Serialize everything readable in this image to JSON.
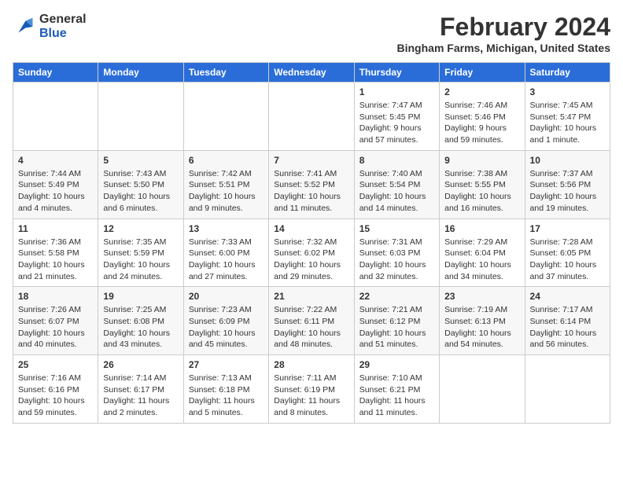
{
  "header": {
    "logo_line1": "General",
    "logo_line2": "Blue",
    "month_year": "February 2024",
    "location": "Bingham Farms, Michigan, United States"
  },
  "weekdays": [
    "Sunday",
    "Monday",
    "Tuesday",
    "Wednesday",
    "Thursday",
    "Friday",
    "Saturday"
  ],
  "weeks": [
    [
      {
        "day": "",
        "info": ""
      },
      {
        "day": "",
        "info": ""
      },
      {
        "day": "",
        "info": ""
      },
      {
        "day": "",
        "info": ""
      },
      {
        "day": "1",
        "info": "Sunrise: 7:47 AM\nSunset: 5:45 PM\nDaylight: 9 hours\nand 57 minutes."
      },
      {
        "day": "2",
        "info": "Sunrise: 7:46 AM\nSunset: 5:46 PM\nDaylight: 9 hours\nand 59 minutes."
      },
      {
        "day": "3",
        "info": "Sunrise: 7:45 AM\nSunset: 5:47 PM\nDaylight: 10 hours\nand 1 minute."
      }
    ],
    [
      {
        "day": "4",
        "info": "Sunrise: 7:44 AM\nSunset: 5:49 PM\nDaylight: 10 hours\nand 4 minutes."
      },
      {
        "day": "5",
        "info": "Sunrise: 7:43 AM\nSunset: 5:50 PM\nDaylight: 10 hours\nand 6 minutes."
      },
      {
        "day": "6",
        "info": "Sunrise: 7:42 AM\nSunset: 5:51 PM\nDaylight: 10 hours\nand 9 minutes."
      },
      {
        "day": "7",
        "info": "Sunrise: 7:41 AM\nSunset: 5:52 PM\nDaylight: 10 hours\nand 11 minutes."
      },
      {
        "day": "8",
        "info": "Sunrise: 7:40 AM\nSunset: 5:54 PM\nDaylight: 10 hours\nand 14 minutes."
      },
      {
        "day": "9",
        "info": "Sunrise: 7:38 AM\nSunset: 5:55 PM\nDaylight: 10 hours\nand 16 minutes."
      },
      {
        "day": "10",
        "info": "Sunrise: 7:37 AM\nSunset: 5:56 PM\nDaylight: 10 hours\nand 19 minutes."
      }
    ],
    [
      {
        "day": "11",
        "info": "Sunrise: 7:36 AM\nSunset: 5:58 PM\nDaylight: 10 hours\nand 21 minutes."
      },
      {
        "day": "12",
        "info": "Sunrise: 7:35 AM\nSunset: 5:59 PM\nDaylight: 10 hours\nand 24 minutes."
      },
      {
        "day": "13",
        "info": "Sunrise: 7:33 AM\nSunset: 6:00 PM\nDaylight: 10 hours\nand 27 minutes."
      },
      {
        "day": "14",
        "info": "Sunrise: 7:32 AM\nSunset: 6:02 PM\nDaylight: 10 hours\nand 29 minutes."
      },
      {
        "day": "15",
        "info": "Sunrise: 7:31 AM\nSunset: 6:03 PM\nDaylight: 10 hours\nand 32 minutes."
      },
      {
        "day": "16",
        "info": "Sunrise: 7:29 AM\nSunset: 6:04 PM\nDaylight: 10 hours\nand 34 minutes."
      },
      {
        "day": "17",
        "info": "Sunrise: 7:28 AM\nSunset: 6:05 PM\nDaylight: 10 hours\nand 37 minutes."
      }
    ],
    [
      {
        "day": "18",
        "info": "Sunrise: 7:26 AM\nSunset: 6:07 PM\nDaylight: 10 hours\nand 40 minutes."
      },
      {
        "day": "19",
        "info": "Sunrise: 7:25 AM\nSunset: 6:08 PM\nDaylight: 10 hours\nand 43 minutes."
      },
      {
        "day": "20",
        "info": "Sunrise: 7:23 AM\nSunset: 6:09 PM\nDaylight: 10 hours\nand 45 minutes."
      },
      {
        "day": "21",
        "info": "Sunrise: 7:22 AM\nSunset: 6:11 PM\nDaylight: 10 hours\nand 48 minutes."
      },
      {
        "day": "22",
        "info": "Sunrise: 7:21 AM\nSunset: 6:12 PM\nDaylight: 10 hours\nand 51 minutes."
      },
      {
        "day": "23",
        "info": "Sunrise: 7:19 AM\nSunset: 6:13 PM\nDaylight: 10 hours\nand 54 minutes."
      },
      {
        "day": "24",
        "info": "Sunrise: 7:17 AM\nSunset: 6:14 PM\nDaylight: 10 hours\nand 56 minutes."
      }
    ],
    [
      {
        "day": "25",
        "info": "Sunrise: 7:16 AM\nSunset: 6:16 PM\nDaylight: 10 hours\nand 59 minutes."
      },
      {
        "day": "26",
        "info": "Sunrise: 7:14 AM\nSunset: 6:17 PM\nDaylight: 11 hours\nand 2 minutes."
      },
      {
        "day": "27",
        "info": "Sunrise: 7:13 AM\nSunset: 6:18 PM\nDaylight: 11 hours\nand 5 minutes."
      },
      {
        "day": "28",
        "info": "Sunrise: 7:11 AM\nSunset: 6:19 PM\nDaylight: 11 hours\nand 8 minutes."
      },
      {
        "day": "29",
        "info": "Sunrise: 7:10 AM\nSunset: 6:21 PM\nDaylight: 11 hours\nand 11 minutes."
      },
      {
        "day": "",
        "info": ""
      },
      {
        "day": "",
        "info": ""
      }
    ]
  ]
}
